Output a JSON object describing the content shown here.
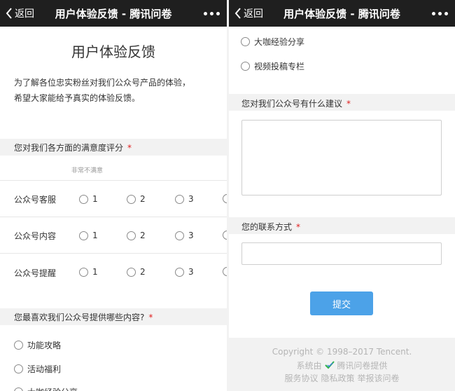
{
  "nav": {
    "back_label": "返回",
    "title": "用户体验反馈 - 腾讯问卷"
  },
  "survey": {
    "title": "用户体验反馈",
    "intro_line1": "为了解各位忠实粉丝对我们公众号产品的体验，",
    "intro_line2": "希望大家能给予真实的体验反馈。"
  },
  "q1": {
    "title": "您对我们各方面的满意度评分",
    "required_mark": "*",
    "scale_hint": "非常不满意",
    "rows": [
      {
        "label": "公众号客服",
        "options": [
          "1",
          "2",
          "3"
        ]
      },
      {
        "label": "公众号内容",
        "options": [
          "1",
          "2",
          "3"
        ]
      },
      {
        "label": "公众号提醒",
        "options": [
          "1",
          "2",
          "3"
        ]
      }
    ]
  },
  "q2": {
    "title": "您最喜欢我们公众号提供哪些内容?",
    "required_mark": "*",
    "options": [
      "功能攻略",
      "活动福利",
      "大咖经验分享",
      "视频投稿专栏"
    ]
  },
  "q3": {
    "title": "您对我们公众号有什么建议",
    "required_mark": "*",
    "value": ""
  },
  "q4": {
    "title": "您的联系方式",
    "required_mark": "*",
    "value": ""
  },
  "submit_label": "提交",
  "footer": {
    "copyright": "Copyright © 1998–2017 Tencent.",
    "provided_prefix": "系统由",
    "provided_brand": "腾讯问卷提供",
    "links": [
      "服务协议",
      "隐私政策",
      "举报该问卷"
    ]
  },
  "colors": {
    "navbar": "#1f1f1f",
    "required": "#e02020",
    "submit": "#4ca2e8",
    "section_band": "#f2f2f2",
    "brand_check": [
      "#2bb24c",
      "#3b82d6"
    ]
  },
  "icons": [
    "chevron-left-icon",
    "more-dots-icon",
    "radio-icon",
    "tencent-wenjuan-logo-icon"
  ]
}
